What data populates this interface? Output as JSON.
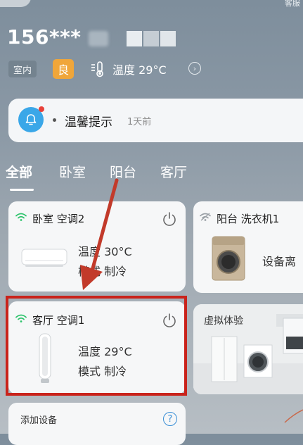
{
  "header": {
    "service_label": "客服",
    "phone_masked": "156***"
  },
  "env": {
    "indoor_label": "室内",
    "air_quality": "良",
    "temperature_text": "温度 29°C",
    "chevron": "›"
  },
  "tip": {
    "title": "温馨提示",
    "time": "1天前"
  },
  "tabs": [
    {
      "label": "全部"
    },
    {
      "label": "卧室"
    },
    {
      "label": "阳台"
    },
    {
      "label": "客厅"
    }
  ],
  "devices": [
    {
      "name": "卧室 空调2",
      "temp": "温度 30°C",
      "mode": "模式 制冷"
    },
    {
      "name": "阳台 洗衣机1",
      "status": "设备离"
    },
    {
      "name": "客厅 空调1",
      "temp": "温度 29°C",
      "mode": "模式 制冷"
    }
  ],
  "virtual": {
    "label": "虚拟体验"
  },
  "add_device": {
    "label": "添加设备",
    "help": "?"
  },
  "colors": {
    "highlight": "#c9231b",
    "arrow": "#c23a2a",
    "air_quality_badge": "#f0a63a",
    "bell": "#3aa7e8",
    "wifi_online": "#2cc36b"
  }
}
